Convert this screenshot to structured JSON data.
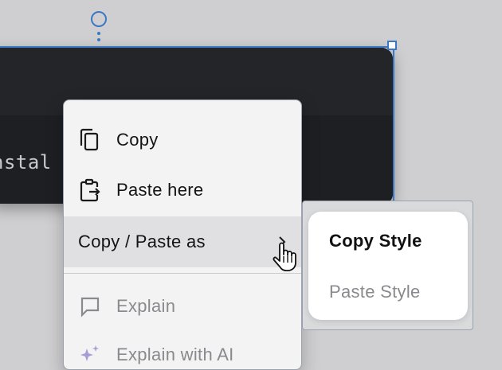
{
  "code_window": {
    "visible_text": "nstal"
  },
  "context_menu": {
    "items": [
      {
        "label": "Copy",
        "icon": "copy-icon",
        "enabled": true
      },
      {
        "label": "Paste here",
        "icon": "paste-icon",
        "enabled": true
      },
      {
        "label": "Copy / Paste as",
        "icon": "chevron-right-icon",
        "enabled": true,
        "hovered": true
      },
      {
        "label": "Explain",
        "icon": "comment-icon",
        "enabled": false
      },
      {
        "label": "Explain with AI",
        "icon": "sparkle-icon",
        "enabled": false
      }
    ]
  },
  "submenu": {
    "items": [
      {
        "label": "Copy Style",
        "enabled": true
      },
      {
        "label": "Paste Style",
        "enabled": false
      }
    ]
  },
  "colors": {
    "canvas": "#cfcfd1",
    "selection": "#3b78c4",
    "menu_bg": "#f3f3f4",
    "menu_hover": "#e0e0e2",
    "disabled_text": "#8a8a8e"
  }
}
